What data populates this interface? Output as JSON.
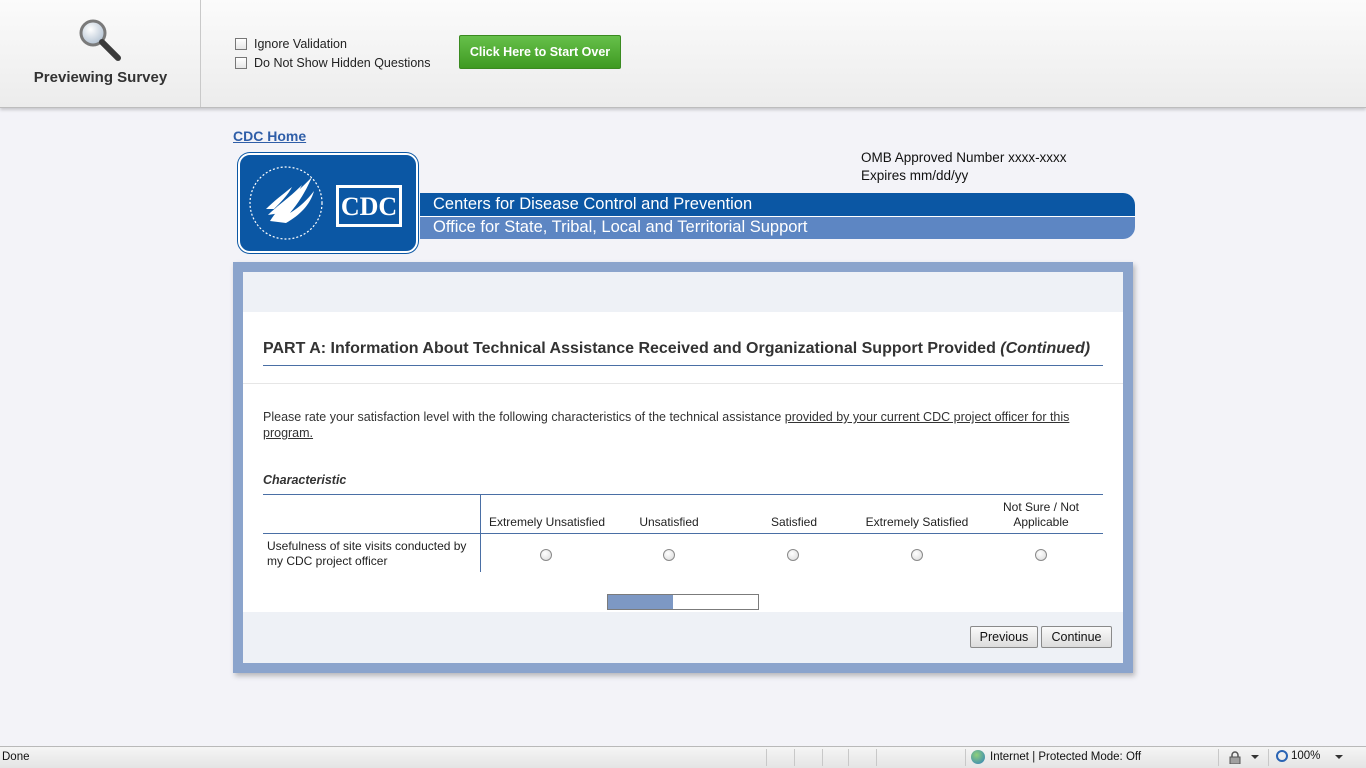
{
  "preview": {
    "title": "Previewing Survey",
    "ignore_validation_label": "Ignore Validation",
    "hide_hidden_label": "Do Not Show Hidden Questions",
    "start_over_label": "Click Here to Start Over"
  },
  "header": {
    "home_link": "CDC Home",
    "omb_line1": "OMB Approved Number xxxx-xxxx",
    "omb_line2": "Expires mm/dd/yy",
    "logo_text": "CDC",
    "banner_line1": "Centers for Disease Control and Prevention",
    "banner_line2": "Office for State, Tribal, Local and Territorial Support"
  },
  "survey": {
    "part_title": "PART A: Information About Technical Assistance Received and Organizational Support Provided",
    "part_title_suffix": "(Continued)",
    "instructions_plain": "Please rate your satisfaction level with the following characteristics of the technical assistance ",
    "instructions_underlined": "provided by your current CDC project officer for this program.",
    "characteristic_label": "Characteristic",
    "columns": [
      "Extremely Unsatisfied",
      "Unsatisfied",
      "Satisfied",
      "Extremely Satisfied",
      "Not Sure / Not Applicable"
    ],
    "rows": [
      {
        "label": "Usefulness of site visits conducted by my CDC project officer"
      }
    ],
    "progress_fraction": 0.43,
    "previous_label": "Previous",
    "continue_label": "Continue"
  },
  "statusbar": {
    "status": "Done",
    "zone": "Internet | Protected Mode: Off",
    "zoom": "100%"
  },
  "colors": {
    "cdc_blue": "#0b57a4",
    "cdc_light_blue": "#5d86c3",
    "frame": "#8ba4cc",
    "green_button": "#4fae32"
  }
}
